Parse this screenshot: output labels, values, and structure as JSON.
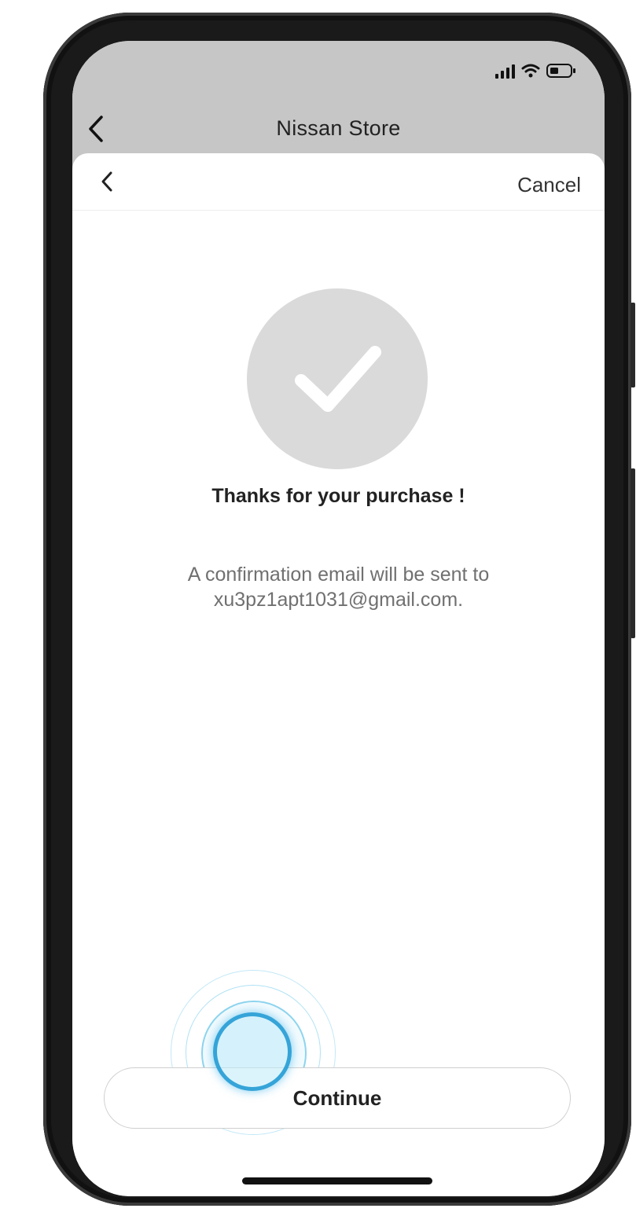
{
  "app_bar": {
    "title": "Nissan Store"
  },
  "sheet": {
    "cancel_label": "Cancel",
    "title": "Thanks for your purchase !",
    "message_line1": "A confirmation email will be sent to",
    "message_line2": "xu3pz1apt1031@gmail.com."
  },
  "actions": {
    "continue_label": "Continue"
  },
  "icons": {
    "back": "chevron-left-icon",
    "success": "checkmark-icon",
    "signal": "signal-icon",
    "wifi": "wifi-icon",
    "battery": "battery-icon"
  },
  "colors": {
    "header_bg": "#c6c6c6",
    "success_circle": "#dadada",
    "tap_highlight": "#1996d2"
  }
}
